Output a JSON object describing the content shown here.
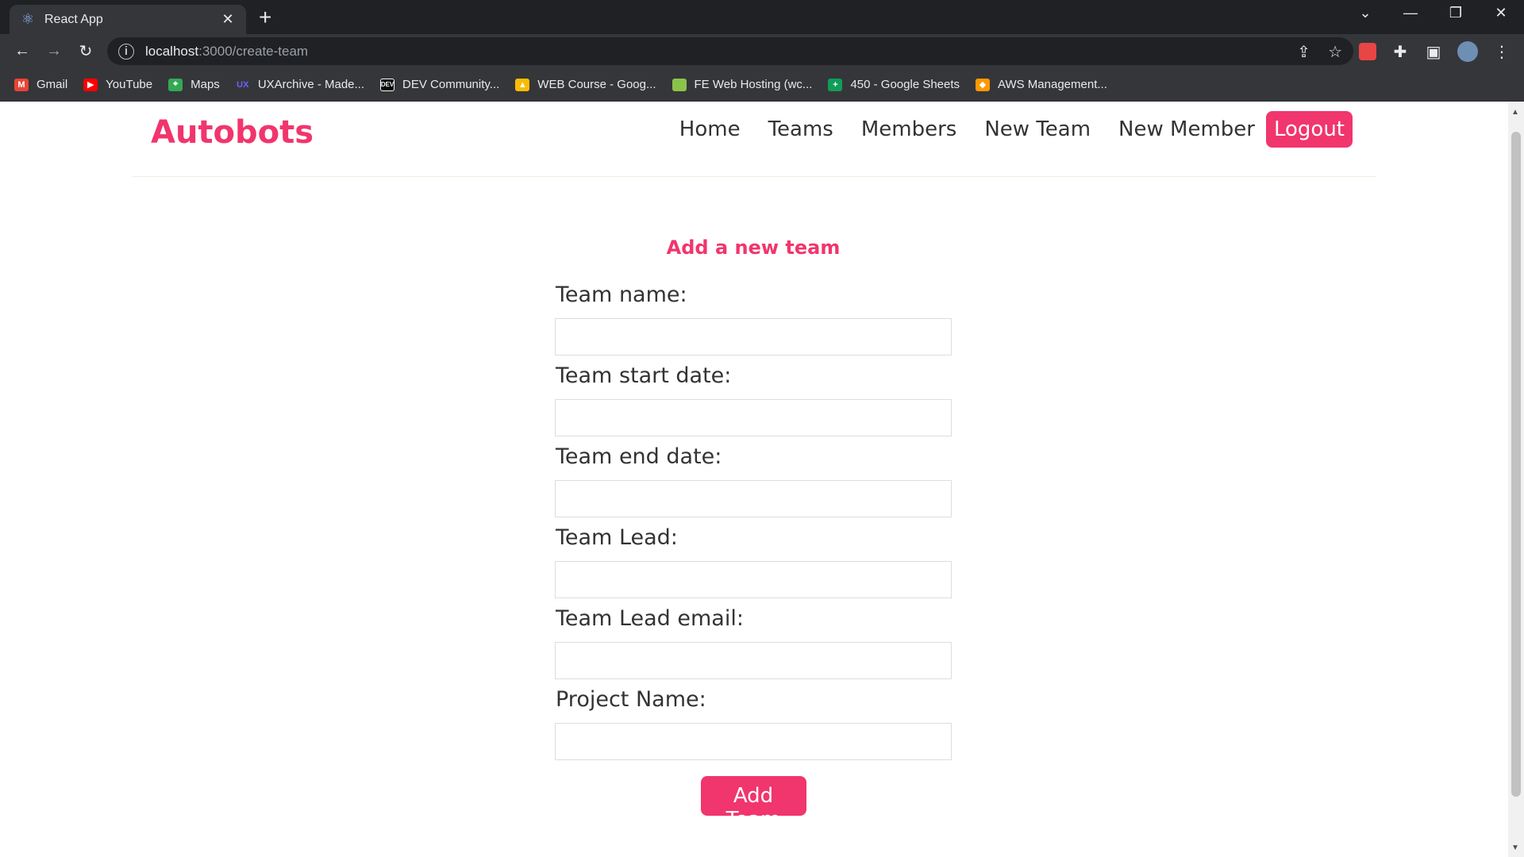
{
  "browser": {
    "tab_title": "React App",
    "url_host": "localhost",
    "url_path": ":3000/create-team",
    "bookmarks": [
      {
        "label": "Gmail",
        "color": "#ea4335"
      },
      {
        "label": "YouTube",
        "color": "#ff0000"
      },
      {
        "label": "Maps",
        "color": "#34a853"
      },
      {
        "label": "UXArchive - Made...",
        "color": "#6c63ff"
      },
      {
        "label": "DEV Community...",
        "color": "#000000"
      },
      {
        "label": "WEB Course - Goog...",
        "color": "#fbbc04"
      },
      {
        "label": "FE Web Hosting (wc...",
        "color": "#8bc34a"
      },
      {
        "label": "450 - Google Sheets",
        "color": "#0f9d58"
      },
      {
        "label": "AWS Management...",
        "color": "#ff9900"
      }
    ]
  },
  "navbar": {
    "brand": "Autobots",
    "links": [
      "Home",
      "Teams",
      "Members",
      "New Team",
      "New Member"
    ],
    "logout": "Logout"
  },
  "form": {
    "title": "Add a new team",
    "fields": [
      {
        "label": "Team name:",
        "value": ""
      },
      {
        "label": "Team start date:",
        "value": ""
      },
      {
        "label": "Team end date:",
        "value": ""
      },
      {
        "label": "Team Lead:",
        "value": ""
      },
      {
        "label": "Team Lead email:",
        "value": ""
      },
      {
        "label": "Project Name:",
        "value": ""
      }
    ],
    "submit": "Add Team"
  },
  "colors": {
    "accent": "#f1356d",
    "text": "#333333"
  }
}
